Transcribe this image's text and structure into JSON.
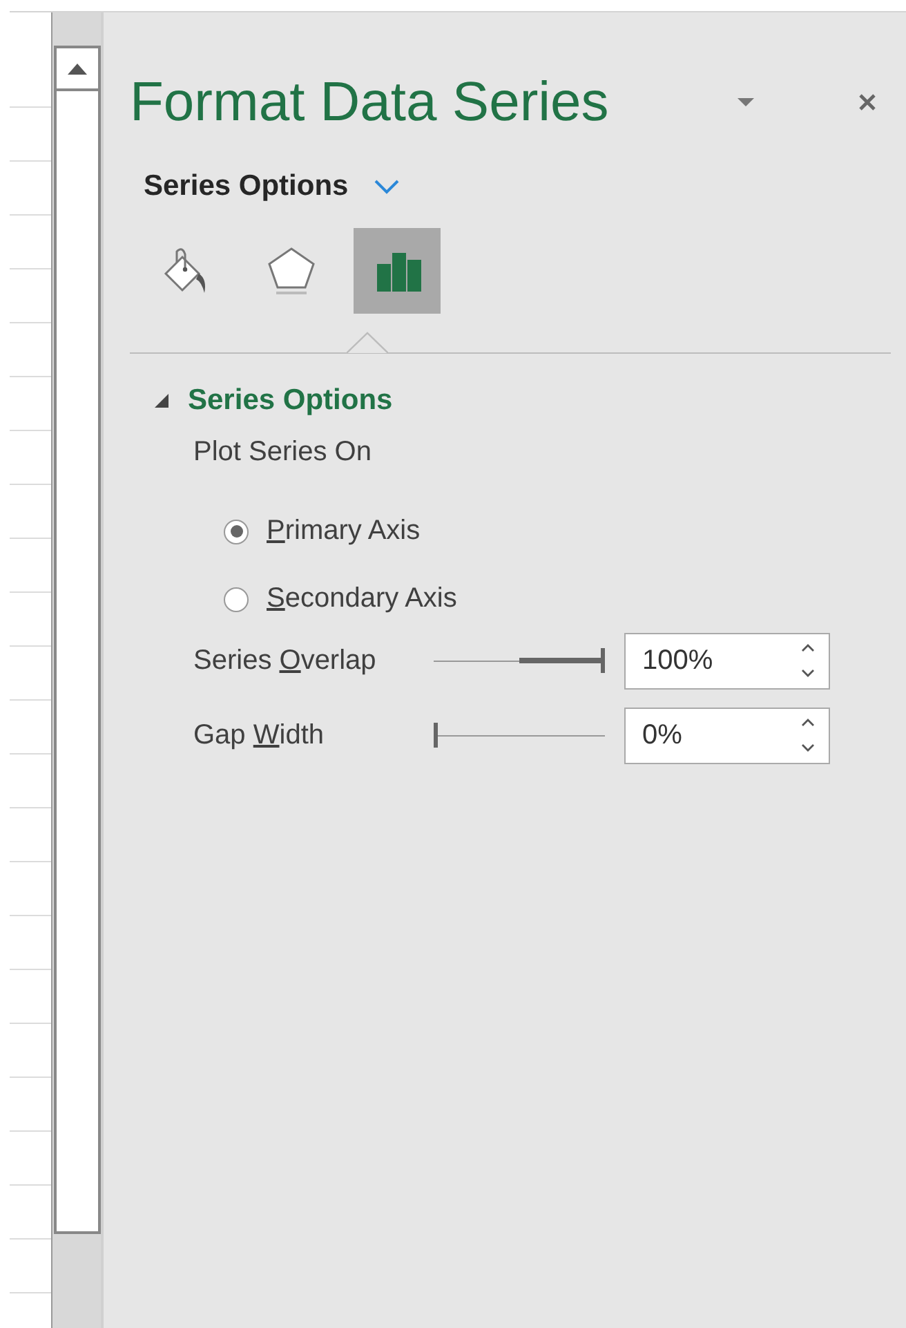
{
  "pane": {
    "title": "Format Data Series",
    "category": "Series Options"
  },
  "tabs": [
    {
      "kind": "fill",
      "selected": false
    },
    {
      "kind": "effects",
      "selected": false
    },
    {
      "kind": "series",
      "selected": true
    }
  ],
  "section": {
    "title": "Series Options",
    "expanded": true,
    "group_label": "Plot Series On",
    "radios": [
      {
        "access_key": "P",
        "label_rest": "rimary Axis",
        "selected": true
      },
      {
        "access_key": "S",
        "label_rest": "econdary Axis",
        "selected": false
      }
    ],
    "sliders": [
      {
        "label_start": "Series ",
        "access_key": "O",
        "label_rest": "verlap",
        "kind": "centered",
        "level": 1,
        "value": "100%"
      },
      {
        "label_start": "Gap ",
        "access_key": "W",
        "label_rest": "idth",
        "kind": "plain",
        "level": 0,
        "value": "0%"
      }
    ]
  }
}
